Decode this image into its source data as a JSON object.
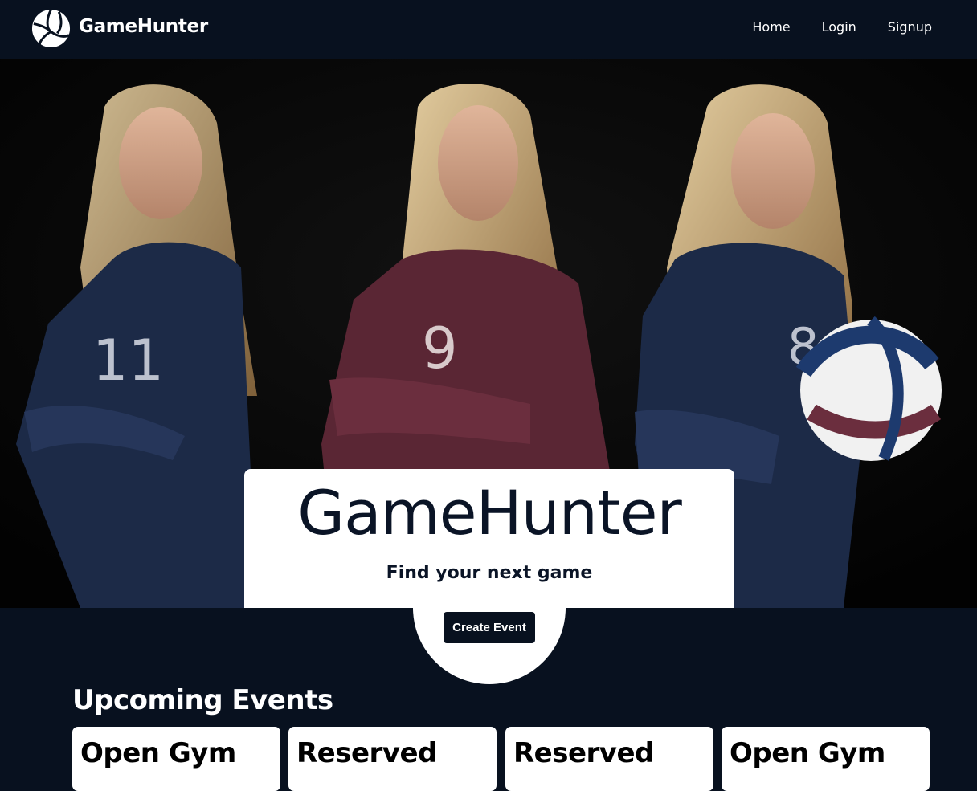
{
  "nav": {
    "brand": "GameHunter",
    "links": [
      "Home",
      "Login",
      "Signup"
    ]
  },
  "hero": {
    "title": "GameHunter",
    "subtitle": "Find your next game",
    "cta": "Create Event",
    "image_description_icon": "volleyball-players-photo"
  },
  "events": {
    "heading": "Upcoming Events",
    "cards": [
      {
        "title": "Open Gym"
      },
      {
        "title": "Reserved"
      },
      {
        "title": "Reserved"
      },
      {
        "title": "Open Gym"
      }
    ]
  },
  "colors": {
    "navy": "#08111f",
    "white": "#ffffff",
    "jersey_navy": "#1c2a47",
    "jersey_maroon": "#5a2634",
    "hair_blonde": "#c9a876"
  }
}
